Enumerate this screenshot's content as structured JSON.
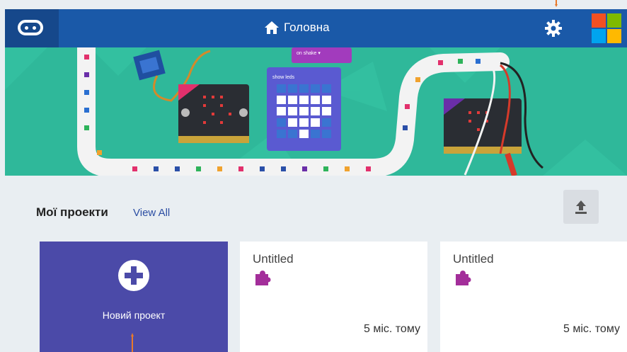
{
  "header": {
    "title": "Головна",
    "colors": {
      "bar": "#1a59a8",
      "logo_bg": "#16488b"
    }
  },
  "projects": {
    "heading": "Мої проекти",
    "view_all": "View All",
    "new_project_label": "Новий проект",
    "items": [
      {
        "title": "Untitled",
        "time": "5 міс. тому"
      },
      {
        "title": "Untitled",
        "time": "5 міс. тому"
      }
    ]
  },
  "icons": {
    "logo": "microbit-logo-icon",
    "home": "home-icon",
    "settings": "gear-icon",
    "brand": "microsoft-logo-icon",
    "upload": "upload-icon",
    "add": "plus-circle-icon",
    "project": "puzzle-icon"
  },
  "hero": {
    "code_blocks": {
      "on_shake": "on  shake ▾",
      "show_leds": "show leds"
    }
  }
}
